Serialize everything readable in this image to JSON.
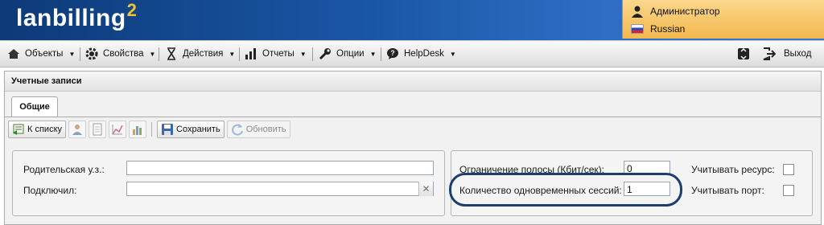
{
  "header": {
    "logo_text": "lanbilling",
    "logo_sup": "2",
    "user_name": "Администратор",
    "language": "Russian"
  },
  "menu": {
    "objects": "Объекты",
    "properties": "Свойства",
    "actions": "Действия",
    "reports": "Отчеты",
    "options": "Опции",
    "helpdesk": "HelpDesk",
    "exit": "Выход"
  },
  "panel": {
    "title": "Учетные записи",
    "tab_general": "Общие"
  },
  "toolbar": {
    "to_list": "К списку",
    "save": "Сохранить",
    "refresh": "Обновить"
  },
  "form": {
    "parent_label": "Родительская у.з.:",
    "parent_value": "",
    "connected_label": "Подключил:",
    "connected_value": "",
    "bandwidth_label": "Ограничение полосы (Кбит/сек):",
    "bandwidth_value": "0",
    "sessions_label": "Количество одновременных сессий:",
    "sessions_value": "1",
    "count_resource_label": "Учитывать ресурс:",
    "count_port_label": "Учитывать порт:"
  },
  "colors": {
    "header_blue": "#1a56a6",
    "user_box": "#f3b84e",
    "highlight_ring": "#1a3e6e"
  }
}
